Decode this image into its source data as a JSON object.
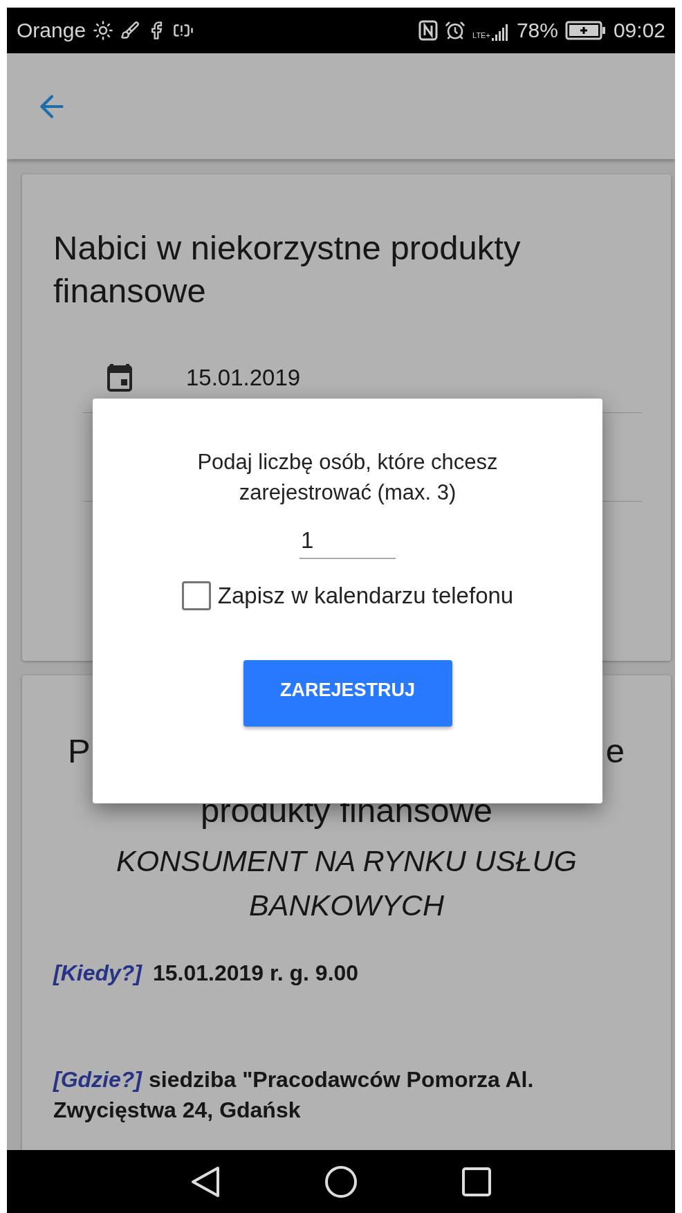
{
  "status_bar": {
    "carrier": "Orange",
    "network": "LTE+",
    "battery": "78%",
    "time": "09:02"
  },
  "event_card": {
    "title": "Nabici w niekorzystne produkty finansowe",
    "date": "15.01.2019"
  },
  "detail_card": {
    "title_fragments": [
      "P",
      "e"
    ],
    "title_line_2": "produkty finansowe",
    "heading": "KONSUMENT NA RYNKU USŁUG BANKOWYCH",
    "details": [
      {
        "label": "[Kiedy?]",
        "text": "15.01.2019 r. g. 9.00"
      },
      {
        "label": "[Gdzie?]",
        "text": "siedziba \"Pracodawców Pomorza Al. Zwycięstwa 24, Gdańsk"
      }
    ]
  },
  "dialog": {
    "prompt": "Podaj liczbę osób, które chcesz zarejestrować (max. 3)",
    "count": "1",
    "checkbox": {
      "label": "Zapisz w kalendarzu telefonu",
      "checked": false
    },
    "button": "ZAREJESTRUJ"
  }
}
